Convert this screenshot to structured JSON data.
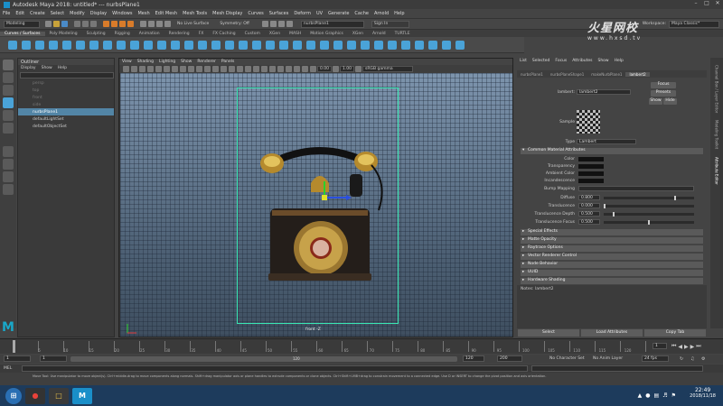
{
  "titlebar": {
    "title": "Autodesk Maya 2018: untitled*   ---   nurbsPlane1",
    "min": "–",
    "max": "□",
    "close": "✕"
  },
  "menubar": [
    "File",
    "Edit",
    "Create",
    "Select",
    "Modify",
    "Display",
    "Windows",
    "Mesh",
    "Edit Mesh",
    "Mesh Tools",
    "Mesh Display",
    "Curves",
    "Surfaces",
    "Deform",
    "UV",
    "Generate",
    "Cache",
    "Arnold",
    "Help"
  ],
  "statusline": {
    "menuset": "Modeling",
    "no_live_surface": "No Live Surface",
    "symmetry": "Symmetry: Off",
    "object_name": "nurbsPlane1",
    "sign_in": "Sign In",
    "workspace_label": "Workspace:",
    "workspace": "Maya Classic*"
  },
  "shelf_tabs": [
    "Curves / Surfaces",
    "Poly Modeling",
    "Sculpting",
    "Rigging",
    "Animation",
    "Rendering",
    "FX",
    "FX Caching",
    "Custom",
    "XGen",
    "MASH",
    "Motion Graphics",
    "XGen",
    "Arnold",
    "TURTLE"
  ],
  "outliner": {
    "title": "Outliner",
    "menu": [
      "Display",
      "Show",
      "Help"
    ],
    "items": [
      {
        "label": "persp",
        "state": "dim"
      },
      {
        "label": "top",
        "state": "dim"
      },
      {
        "label": "front",
        "state": "dim"
      },
      {
        "label": "side",
        "state": "dim"
      },
      {
        "label": "nurbsPlane1",
        "state": "selected"
      },
      {
        "label": "defaultLightSet",
        "state": "normal"
      },
      {
        "label": "defaultObjectSet",
        "state": "normal"
      }
    ]
  },
  "viewport": {
    "menu": [
      "View",
      "Shading",
      "Lighting",
      "Show",
      "Renderer",
      "Panels"
    ],
    "field_a": "0.00",
    "field_b": "1.00",
    "colorspace": "sRGB gamma",
    "camera": "front -Z"
  },
  "attribute_editor": {
    "menu": [
      "List",
      "Selected",
      "Focus",
      "Attributes",
      "Show",
      "Help"
    ],
    "tabs": [
      "nurbsPlane1",
      "nurbsPlaneShape1",
      "makeNurbPlane1",
      "lambert2"
    ],
    "node_label": "lambert:",
    "node_name": "lambert2",
    "focus": "Focus",
    "presets": "Presets",
    "show": "Show",
    "hide": "Hide",
    "sample_label": "Sample",
    "type_label": "Type",
    "type_value": "Lambert",
    "section_common": "Common Material Attributes",
    "attrs": [
      {
        "label": "Color",
        "kind": "swatch"
      },
      {
        "label": "Transparency",
        "kind": "swatch"
      },
      {
        "label": "Ambient Color",
        "kind": "swatch"
      },
      {
        "label": "Incandescence",
        "kind": "swatch"
      },
      {
        "label": "Bump Mapping",
        "kind": "empty"
      },
      {
        "label": "Diffuse",
        "value": "0.800",
        "slider": 0.8
      },
      {
        "label": "Translucence",
        "value": "0.000",
        "slider": 0.0
      },
      {
        "label": "Translucence Depth",
        "value": "0.500",
        "slider": 0.1
      },
      {
        "label": "Translucence Focus",
        "value": "0.500",
        "slider": 0.5
      }
    ],
    "sections": [
      "Special Effects",
      "Matte Opacity",
      "Raytrace Options",
      "Vector Renderer Control",
      "Node Behavior",
      "UUID",
      "Hardware Shading"
    ],
    "notes_label": "Notes:",
    "notes_value": "lambert2",
    "buttons": [
      "Select",
      "Load Attributes",
      "Copy Tab"
    ]
  },
  "side_tabs": [
    "Channel Box / Layer Editor",
    "Modeling Toolkit",
    "Attribute Editor"
  ],
  "timeline": {
    "labels": [
      "1",
      "5",
      "10",
      "15",
      "20",
      "25",
      "30",
      "35",
      "40",
      "45",
      "50",
      "55",
      "60",
      "65",
      "70",
      "75",
      "80",
      "85",
      "90",
      "95",
      "100",
      "105",
      "110",
      "115",
      "120"
    ],
    "current": "1"
  },
  "range": {
    "start": "1",
    "play_start": "1",
    "mid": "120",
    "play_end": "120",
    "end": "200",
    "character_set": "No Character Set",
    "anim_layer": "No Anim Layer",
    "fps": "24 fps"
  },
  "command": {
    "lang": "MEL"
  },
  "helpline": "Move Tool: Use manipulator to move object(s). Ctrl+middle-drag to move components along normals. Shift+drag manipulator axis or plane handles to extrude components or clone objects. Ctrl+Shift+LMB+drag to constrain movement to a connected edge. Use D or INSERT to change the pivot position and axis orientation.",
  "taskbar": {
    "time": "22:49",
    "date": "2018/11/18"
  },
  "watermark": {
    "cn": "火星网校",
    "url": "www.hxsd.tv"
  },
  "colors": {
    "accent": "#5285a6",
    "plane_outline": "#39e6b3",
    "taskbar": "#1d3b5c"
  }
}
